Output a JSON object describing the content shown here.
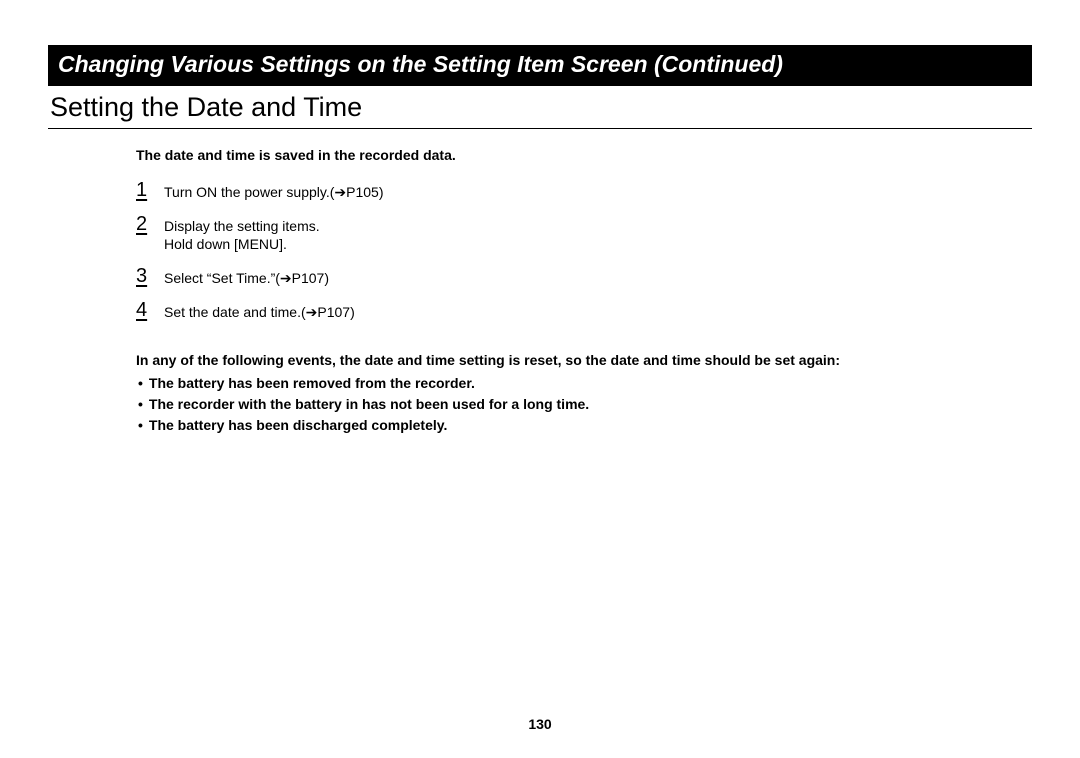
{
  "chapter_title": "Changing Various Settings on the Setting Item Screen (Continued)",
  "section_title": "Setting the Date and Time",
  "intro": "The date and time is saved in the recorded data.",
  "steps": [
    {
      "num": "1",
      "text": "Turn ON the power supply.(➔P105)"
    },
    {
      "num": "2",
      "text": "Display the setting items.\nHold down [MENU]."
    },
    {
      "num": "3",
      "text": "Select “Set Time.”(➔P107)"
    },
    {
      "num": "4",
      "text": "Set the date and time.(➔P107)"
    }
  ],
  "note_lead": "In any of the following events, the date and time setting is reset, so the date and time should be set again:",
  "note_bullets": [
    "The battery has been removed from the recorder.",
    "The recorder with the battery in has not been used for a long time.",
    "The battery has been discharged completely."
  ],
  "page_number": "130"
}
